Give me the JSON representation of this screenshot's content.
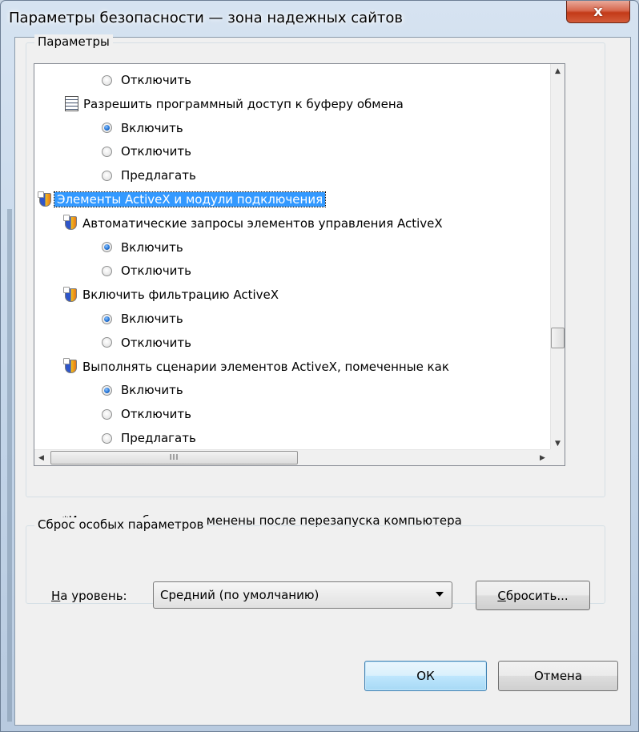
{
  "window": {
    "title": "Параметры безопасности — зона надежных сайтов",
    "close_label": "x"
  },
  "settings": {
    "group_label": "Параметры",
    "rows": [
      {
        "kind": "radio",
        "label": "Отключить",
        "checked": false
      },
      {
        "kind": "category",
        "icon": "clipboard-icon",
        "label": "Разрешить программный доступ к буферу обмена"
      },
      {
        "kind": "radio",
        "label": "Включить",
        "checked": true
      },
      {
        "kind": "radio",
        "label": "Отключить",
        "checked": false
      },
      {
        "kind": "radio",
        "label": "Предлагать",
        "checked": false
      },
      {
        "kind": "section",
        "icon": "shield-icon",
        "label": "Элементы ActiveX и модули подключения",
        "selected": true
      },
      {
        "kind": "category",
        "icon": "shield-icon",
        "label": "Автоматические запросы элементов управления ActiveX"
      },
      {
        "kind": "radio",
        "label": "Включить",
        "checked": true
      },
      {
        "kind": "radio",
        "label": "Отключить",
        "checked": false
      },
      {
        "kind": "category",
        "icon": "shield-icon",
        "label": "Включить фильтрацию ActiveX"
      },
      {
        "kind": "radio",
        "label": "Включить",
        "checked": true
      },
      {
        "kind": "radio",
        "label": "Отключить",
        "checked": false
      },
      {
        "kind": "category",
        "icon": "shield-icon",
        "label": "Выполнять сценарии элементов ActiveX, помеченные как"
      },
      {
        "kind": "radio",
        "label": "Включить",
        "checked": true
      },
      {
        "kind": "radio",
        "label": "Отключить",
        "checked": false
      },
      {
        "kind": "radio",
        "label": "Предлагать",
        "checked": false
      }
    ],
    "hscroll_thumb": "III",
    "note": "*Изменения будут применены после перезапуска компьютера"
  },
  "reset": {
    "group_label": "Сброс особых параметров",
    "level_label_underlined": "Н",
    "level_label_rest": "а уровень:",
    "level_value": "Средний (по умолчанию)",
    "reset_button_underlined": "С",
    "reset_button_rest": "бросить..."
  },
  "buttons": {
    "ok": "ОК",
    "cancel": "Отмена"
  }
}
